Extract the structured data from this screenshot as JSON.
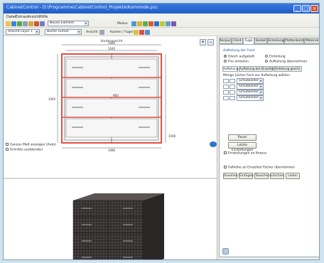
{
  "window": {
    "title": "CabinetControl - D:\\Programme\\CabinetControl_Projekte\\Kommode.pcc"
  },
  "menu": [
    "Datei",
    "Extras",
    "Ansicht",
    "Hilfe"
  ],
  "toolbar": {
    "project_combo": "Neues Element",
    "layer_combo": "Ansicht Layer 1",
    "material_combo": "Buche Furnier",
    "view_label": "Ansicht",
    "edge_label": "Kanten / Fugen",
    "mode_label": "Modus"
  },
  "drawing": {
    "view_title": "Vorderansicht",
    "dim_top": "1080",
    "dim_inner": "1040",
    "dim_left": "1000",
    "dim_center": "960",
    "dim_right": "1000",
    "dim_bottom": "1080",
    "checkbox1": "Ganzes Maß anzeigen (Auto)",
    "checkbox2": "Schnitte ausblenden"
  },
  "tabs": [
    "Korpus",
    "Front",
    "Fuge",
    "Sockel",
    "Einteilung",
    "Plattenkanten",
    "Material"
  ],
  "panel": {
    "group_title": "Aufteilung der Front",
    "radio1": "Gleich aufgeteilt",
    "radio2": "Einteilung",
    "radio3": "Frei einteilen",
    "radio4": "Aufteilung übernehmen",
    "subtabs": [
      "Aufteilung",
      "Aufteilung bei Einzelteilen",
      "Einteilung geschl."
    ],
    "table_header": "Menge  Löcher  Fach zur Aufteilung wählen",
    "rows": [
      "Schubkasten",
      "Schubkasten",
      "Schubkasten",
      "Schubkasten"
    ],
    "btn_reset": "Reset",
    "btn_apply": "Letzte Einstellungen",
    "check1": "Einstellungen an Korpus",
    "check2": "Fallhöhe an Einzelteil Fächer übernehmen",
    "bottom_buttons": [
      "Ansehen",
      "Einfügen",
      "Tauschen",
      "Löschen",
      "Laden"
    ]
  }
}
